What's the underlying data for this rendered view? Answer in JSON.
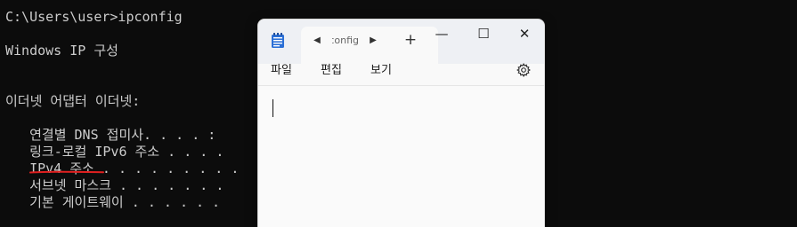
{
  "terminal": {
    "lines": [
      "C:\\Users\\user>ipconfig",
      "Windows IP 구성",
      "이더넷 어댑터 이더넷:",
      "   연결별 DNS 접미사. . . . :",
      "   링크-로컬 IPv6 주소 . . . .",
      "   IPv4 주소 . . . . . . . . .",
      "   서브넷 마스크 . . . . . . .",
      "   기본 게이트웨이 . . . . . ."
    ],
    "text_color": "#cccccc",
    "background": "#0c0c0c",
    "annotation_color": "#e02020"
  },
  "notepad": {
    "tab_title": "ipconfig",
    "tab_prev_icon": "◀",
    "tab_next_icon": "▶",
    "new_tab_icon": "+",
    "minimize_icon": "—",
    "maximize_icon": "☐",
    "close_icon": "✕",
    "menu": {
      "file": "파일",
      "edit": "편집",
      "view": "보기"
    },
    "editor_text": "",
    "icons": {
      "app": "notepad-app-icon",
      "settings": "gear-icon"
    },
    "colors": {
      "titlebar": "#eef0f4",
      "body": "#f9f9f9",
      "app_icon_blue": "#2b6fd6"
    }
  }
}
